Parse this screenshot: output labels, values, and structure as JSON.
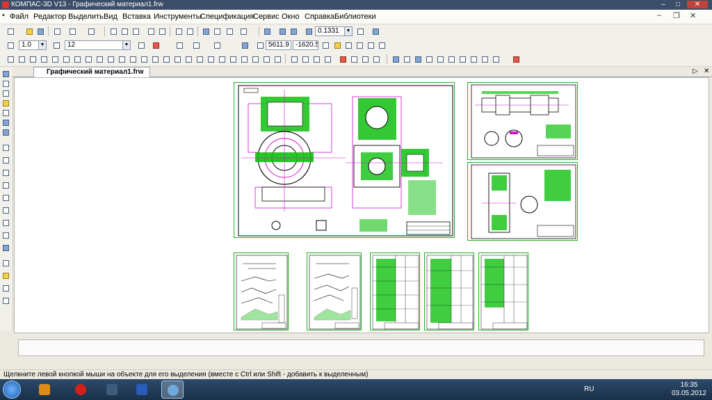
{
  "window": {
    "title": "КОМПАС-3D V13 - Графический материал1.frw"
  },
  "menu": {
    "items": [
      "Файл",
      "Редактор",
      "Выделить",
      "Вид",
      "Вставка",
      "Инструменты",
      "Спецификация",
      "Сервис",
      "Окно",
      "Справка",
      "Библиотеки"
    ]
  },
  "toolbar_std": {
    "zoom_value": "0.1331"
  },
  "toolbar_props": {
    "line_scale": "1.0",
    "step_value": "12",
    "coord_x": "5611.9",
    "coord_y": "-1620.5"
  },
  "document": {
    "tab_label": "Графический материал1.frw"
  },
  "status": {
    "hint": "Щелкните левой кнопкой мыши на объекте для его выделения (вместе с Ctrl или Shift - добавить к выделенным)"
  },
  "taskbar": {
    "language": "RU",
    "time": "16:35",
    "date": "03.05.2012"
  },
  "colors": {
    "drawing_green": "#10c010",
    "drawing_magenta": "#d010d0",
    "drawing_black": "#000000",
    "titlebar": "#3b4d68"
  }
}
